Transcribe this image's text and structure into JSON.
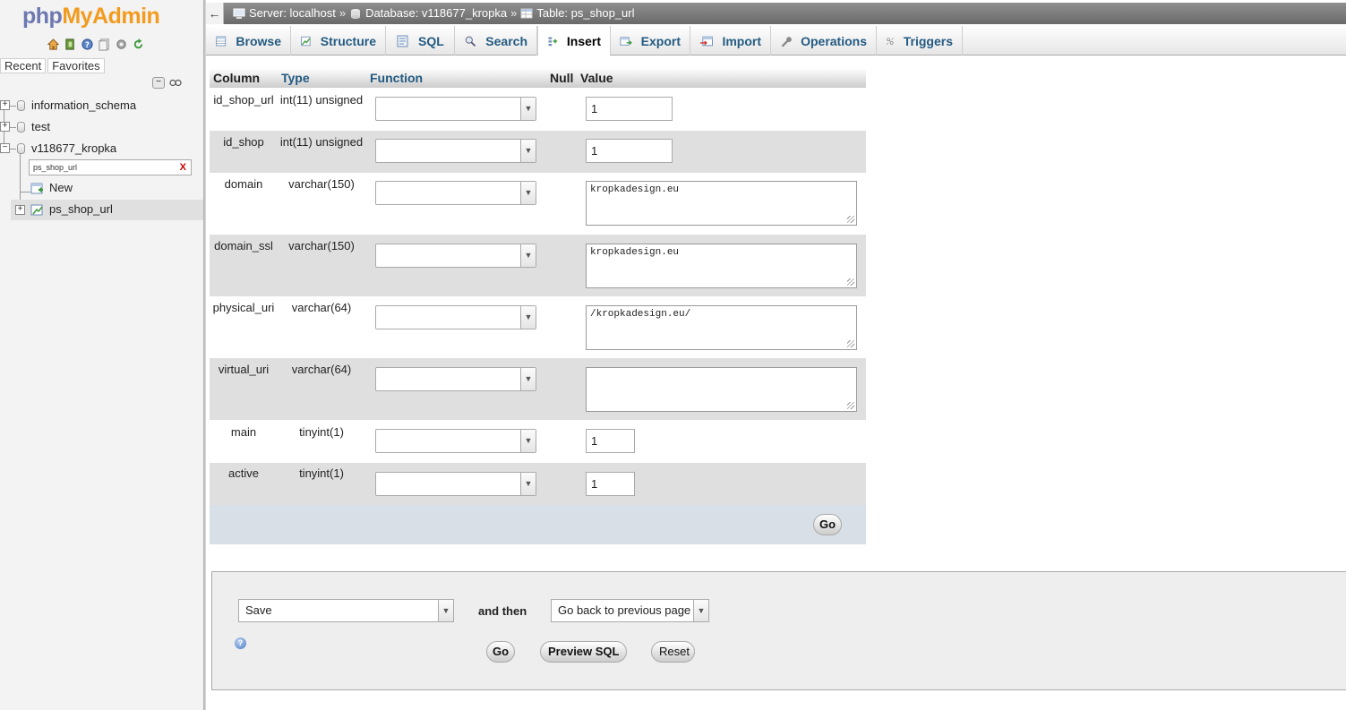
{
  "app": {
    "logo_part1": "php",
    "logo_part2": "MyAdmin"
  },
  "nav": {
    "recent_label": "Recent",
    "favorites_label": "Favorites",
    "databases": [
      {
        "name": "information_schema"
      },
      {
        "name": "test"
      },
      {
        "name": "v118677_kropka"
      }
    ],
    "filter_value": "ps_shop_url",
    "filter_clear": "X",
    "new_label": "New",
    "table_name": "ps_shop_url"
  },
  "breadcrumb": {
    "back": "←",
    "server": "Server: localhost",
    "database": "Database: v118677_kropka",
    "table": "Table: ps_shop_url",
    "separator": "»"
  },
  "tabs": [
    {
      "label": "Browse"
    },
    {
      "label": "Structure"
    },
    {
      "label": "SQL"
    },
    {
      "label": "Search"
    },
    {
      "label": "Insert",
      "active": true
    },
    {
      "label": "Export"
    },
    {
      "label": "Import"
    },
    {
      "label": "Operations"
    },
    {
      "label": "Triggers"
    }
  ],
  "table_header": {
    "column": "Column",
    "type": "Type",
    "function": "Function",
    "null": "Null",
    "value": "Value"
  },
  "rows": [
    {
      "column": "id_shop_url",
      "type": "int(11) unsigned",
      "value": "1"
    },
    {
      "column": "id_shop",
      "type": "int(11) unsigned",
      "value": "1"
    },
    {
      "column": "domain",
      "type": "varchar(150)",
      "value": "kropkadesign.eu"
    },
    {
      "column": "domain_ssl",
      "type": "varchar(150)",
      "value": "kropkadesign.eu"
    },
    {
      "column": "physical_uri",
      "type": "varchar(64)",
      "value": "/kropkadesign.eu/"
    },
    {
      "column": "virtual_uri",
      "type": "varchar(64)",
      "value": ""
    },
    {
      "column": "main",
      "type": "tinyint(1)",
      "value": "1"
    },
    {
      "column": "active",
      "type": "tinyint(1)",
      "value": "1"
    }
  ],
  "go_label": "Go",
  "actions": {
    "save_option": "Save",
    "and_then": "and then",
    "after_option": "Go back to previous page",
    "go": "Go",
    "preview_sql": "Preview SQL",
    "reset": "Reset"
  }
}
